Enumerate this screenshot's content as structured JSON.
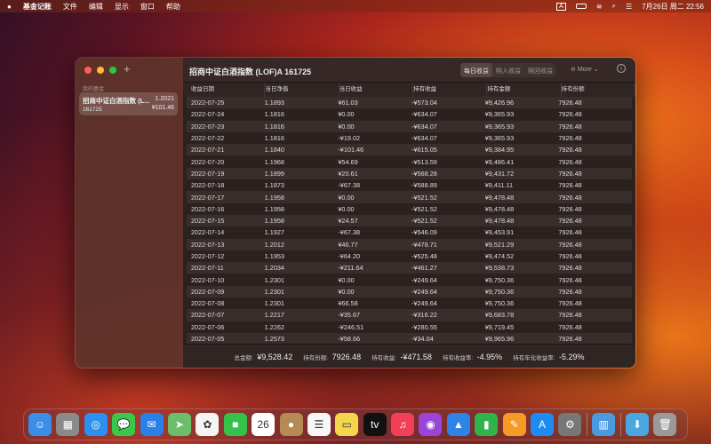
{
  "menubar": {
    "app": "基金记账",
    "items": [
      "文件",
      "编辑",
      "显示",
      "窗口",
      "帮助"
    ],
    "input": "A",
    "datetime": "7月26日 周二 22:56"
  },
  "sidebar": {
    "add": "+",
    "section": "我的基金",
    "fund": {
      "name": "招商中证白酒指数 (L...",
      "code": "161725",
      "nav": "1.2021",
      "profit": "¥101.46"
    }
  },
  "header": {
    "title": "招商中证白酒指数 (LOF)A 161725",
    "tabs": [
      "每日收益",
      "购入收益",
      "赎回收益"
    ],
    "active_tab": 0,
    "more": "More"
  },
  "table": {
    "columns": [
      "收益日期",
      "当日净值",
      "当日收益",
      "持有收益",
      "持有金额",
      "持有份额"
    ],
    "rows": [
      [
        "2022-07-25",
        "1.1893",
        "¥61.03",
        "-¥573.04",
        "¥9,426.96",
        "7926.48"
      ],
      [
        "2022-07-24",
        "1.1816",
        "¥0.00",
        "-¥634.07",
        "¥9,365.93",
        "7926.48"
      ],
      [
        "2022-07-23",
        "1.1816",
        "¥0.00",
        "-¥634.07",
        "¥9,365.93",
        "7926.48"
      ],
      [
        "2022-07-22",
        "1.1816",
        "-¥19.02",
        "-¥634.07",
        "¥9,365.93",
        "7926.48"
      ],
      [
        "2022-07-21",
        "1.1840",
        "-¥101.46",
        "-¥615.05",
        "¥9,384.95",
        "7926.48"
      ],
      [
        "2022-07-20",
        "1.1968",
        "¥54.69",
        "-¥513.59",
        "¥9,486.41",
        "7926.48"
      ],
      [
        "2022-07-19",
        "1.1899",
        "¥20.61",
        "-¥568.28",
        "¥9,431.72",
        "7926.48"
      ],
      [
        "2022-07-18",
        "1.1873",
        "-¥67.38",
        "-¥588.89",
        "¥9,411.11",
        "7926.48"
      ],
      [
        "2022-07-17",
        "1.1958",
        "¥0.00",
        "-¥521.52",
        "¥9,478.48",
        "7926.48"
      ],
      [
        "2022-07-16",
        "1.1958",
        "¥0.00",
        "-¥521.52",
        "¥9,478.48",
        "7926.48"
      ],
      [
        "2022-07-15",
        "1.1958",
        "¥24.57",
        "-¥521.52",
        "¥9,478.48",
        "7926.48"
      ],
      [
        "2022-07-14",
        "1.1927",
        "-¥67.38",
        "-¥546.09",
        "¥9,453.91",
        "7926.48"
      ],
      [
        "2022-07-13",
        "1.2012",
        "¥46.77",
        "-¥478.71",
        "¥9,521.29",
        "7926.48"
      ],
      [
        "2022-07-12",
        "1.1953",
        "-¥64.20",
        "-¥525.48",
        "¥9,474.52",
        "7926.48"
      ],
      [
        "2022-07-11",
        "1.2034",
        "-¥211.64",
        "-¥461.27",
        "¥9,538.73",
        "7926.48"
      ],
      [
        "2022-07-10",
        "1.2301",
        "¥0.00",
        "-¥249.64",
        "¥9,750.36",
        "7926.48"
      ],
      [
        "2022-07-09",
        "1.2301",
        "¥0.00",
        "-¥249.64",
        "¥9,750.36",
        "7926.48"
      ],
      [
        "2022-07-08",
        "1.2301",
        "¥66.58",
        "-¥249.64",
        "¥9,750.36",
        "7926.48"
      ],
      [
        "2022-07-07",
        "1.2217",
        "-¥35.67",
        "-¥316.22",
        "¥9,683.78",
        "7926.48"
      ],
      [
        "2022-07-06",
        "1.2262",
        "-¥246.51",
        "-¥280.55",
        "¥9,719.45",
        "7926.48"
      ],
      [
        "2022-07-05",
        "1.2573",
        "-¥58.66",
        "-¥34.04",
        "¥9,965.96",
        "7926.48"
      ]
    ]
  },
  "footer": [
    {
      "label": "总金额:",
      "value": "¥9,528.42"
    },
    {
      "label": "持有份额:",
      "value": "7926.48"
    },
    {
      "label": "持有收益:",
      "value": "-¥471.58"
    },
    {
      "label": "持有收益率:",
      "value": "-4.95%"
    },
    {
      "label": "持有年化收益率:",
      "value": "-5.29%"
    }
  ],
  "dock": [
    {
      "name": "finder",
      "color": "#3a8ee8",
      "glyph": "☺"
    },
    {
      "name": "launchpad",
      "color": "#8a8a8a",
      "glyph": "▦"
    },
    {
      "name": "safari",
      "color": "#2d8ff0",
      "glyph": "◎"
    },
    {
      "name": "messages",
      "color": "#3ac84a",
      "glyph": "💬"
    },
    {
      "name": "mail",
      "color": "#2a7fe8",
      "glyph": "✉"
    },
    {
      "name": "maps",
      "color": "#6bbf6a",
      "glyph": "➤"
    },
    {
      "name": "photos",
      "color": "#f4f4f4",
      "glyph": "✿"
    },
    {
      "name": "facetime",
      "color": "#35c14a",
      "glyph": "■"
    },
    {
      "name": "calendar",
      "color": "#ffffff",
      "glyph": "26"
    },
    {
      "name": "contacts",
      "color": "#b58a55",
      "glyph": "●"
    },
    {
      "name": "reminders",
      "color": "#f7f7f7",
      "glyph": "☰"
    },
    {
      "name": "notes",
      "color": "#f5d54a",
      "glyph": "▭"
    },
    {
      "name": "apple-tv",
      "color": "#111111",
      "glyph": "tv"
    },
    {
      "name": "music",
      "color": "#f2405a",
      "glyph": "♫"
    },
    {
      "name": "podcasts",
      "color": "#9b45d8",
      "glyph": "◉"
    },
    {
      "name": "keynote",
      "color": "#2f82e6",
      "glyph": "▲"
    },
    {
      "name": "numbers",
      "color": "#2fb34a",
      "glyph": "▮"
    },
    {
      "name": "pages",
      "color": "#f59a25",
      "glyph": "✎"
    },
    {
      "name": "app-store",
      "color": "#1d8cf0",
      "glyph": "A"
    },
    {
      "name": "system-preferences",
      "color": "#777777",
      "glyph": "⚙"
    },
    {
      "sep": true
    },
    {
      "name": "fund-ledger",
      "color": "#4a9ae0",
      "glyph": "▥"
    },
    {
      "sep": true
    },
    {
      "name": "downloads",
      "color": "#4aa6e0",
      "glyph": "⬇"
    },
    {
      "name": "trash",
      "color": "#9a9a9a",
      "glyph": "🗑"
    }
  ]
}
